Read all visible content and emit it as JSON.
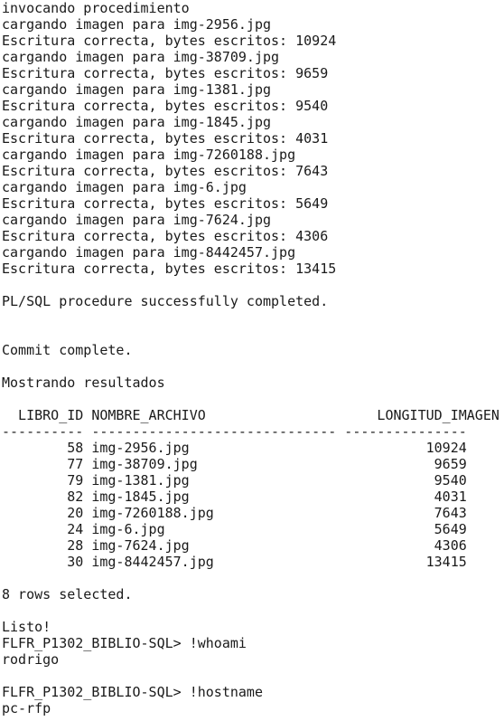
{
  "terminal": {
    "lines": [
      "invocando procedimiento",
      "cargando imagen para img-2956.jpg",
      "Escritura correcta, bytes escritos: 10924",
      "cargando imagen para img-38709.jpg",
      "Escritura correcta, bytes escritos: 9659",
      "cargando imagen para img-1381.jpg",
      "Escritura correcta, bytes escritos: 9540",
      "cargando imagen para img-1845.jpg",
      "Escritura correcta, bytes escritos: 4031",
      "cargando imagen para img-7260188.jpg",
      "Escritura correcta, bytes escritos: 7643",
      "cargando imagen para img-6.jpg",
      "Escritura correcta, bytes escritos: 5649",
      "cargando imagen para img-7624.jpg",
      "Escritura correcta, bytes escritos: 4306",
      "cargando imagen para img-8442457.jpg",
      "Escritura correcta, bytes escritos: 13415",
      "",
      "PL/SQL procedure successfully completed.",
      "",
      "",
      "Commit complete.",
      "",
      "Mostrando resultados",
      "",
      "  LIBRO_ID NOMBRE_ARCHIVO                     LONGITUD_IMAGEN",
      "---------- ------------------------------ ---------------",
      "        58 img-2956.jpg                             10924",
      "        77 img-38709.jpg                             9659",
      "        79 img-1381.jpg                              9540",
      "        82 img-1845.jpg                              4031",
      "        20 img-7260188.jpg                           7643",
      "        24 img-6.jpg                                 5649",
      "        28 img-7624.jpg                              4306",
      "        30 img-8442457.jpg                          13415",
      "",
      "8 rows selected.",
      "",
      "Listo!",
      "FLFR_P1302_BIBLIO-SQL> !whoami",
      "rodrigo",
      "",
      "FLFR_P1302_BIBLIO-SQL> !hostname",
      "pc-rfp"
    ]
  }
}
